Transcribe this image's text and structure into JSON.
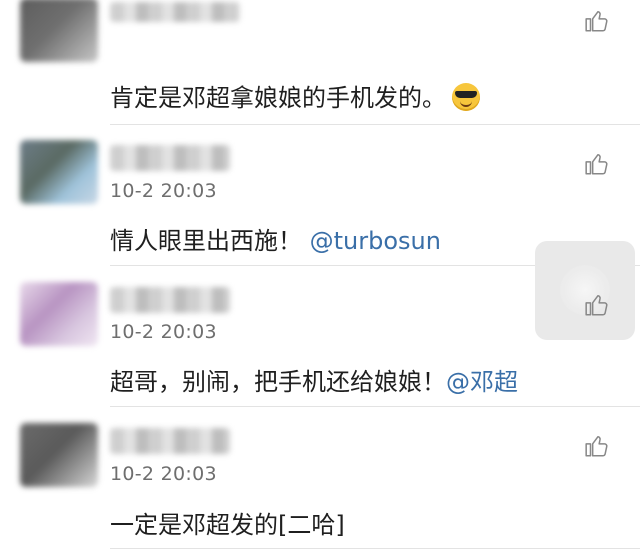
{
  "comments": [
    {
      "text": "肯定是邓超拿娘娘的手机发的。",
      "emoji": "sunglasses-emoji"
    },
    {
      "time": "10-2 20:03",
      "text": "情人眼里出西施！",
      "mention": "@turbosun"
    },
    {
      "time": "10-2 20:03",
      "text": "超哥，别闹，把手机还给娘娘！",
      "mention": "@邓超"
    },
    {
      "time": "10-2 20:03",
      "text": "一定是邓超发的[二哈]"
    }
  ],
  "icons": {
    "like": "thumbs-up-icon"
  },
  "colors": {
    "mention": "#3a6fa8",
    "time": "#6e6e6e",
    "text": "#1f1f1f"
  }
}
